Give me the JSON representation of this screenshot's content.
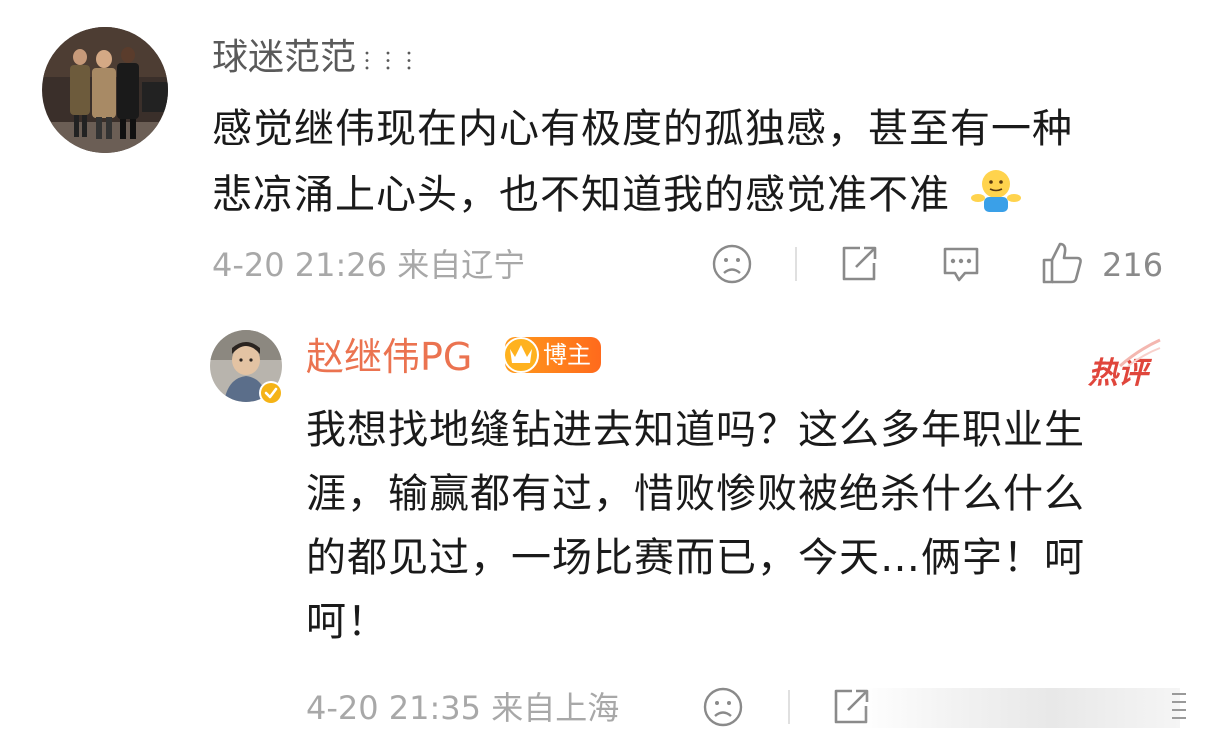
{
  "comment": {
    "username": "球迷范范",
    "text_line1": "感觉继伟现在内心有极度的孤独感，甚至有一种",
    "text_line2": "悲凉涌上心头，也不知道我的感觉准不准",
    "emoji": "shrug-emoji",
    "timestamp": "4-20 21:26 来自辽宁",
    "like_count": "216"
  },
  "reply": {
    "username": "赵继伟PG",
    "badge_label": "博主",
    "hot_tag": "热评",
    "text_line1": "我想找地缝钻进去知道吗？这么多年职业生",
    "text_line2": "涯，输赢都有过，惜败惨败被绝杀什么什么",
    "text_line3": "的都见过，一场比赛而已，今天…俩字！呵",
    "text_line4": "呵！",
    "timestamp": "4-20 21:35 来自上海"
  },
  "colors": {
    "username": "#5a5a5a",
    "reply_username": "#eb7350",
    "meta": "#a8a8a8",
    "badge": "#ff7f1c",
    "hot_tag": "#e0463c"
  }
}
